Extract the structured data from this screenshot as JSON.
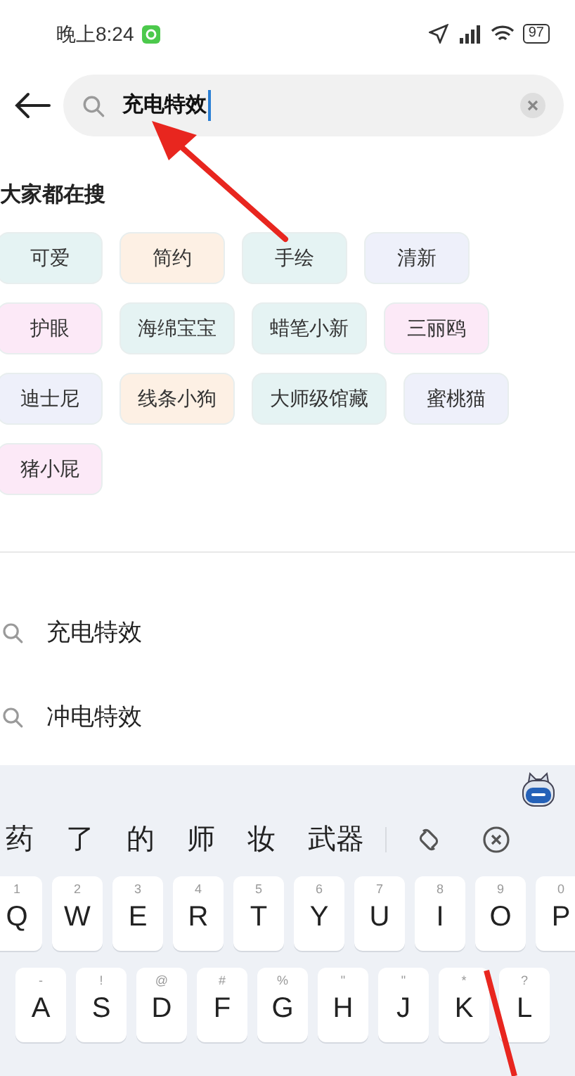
{
  "status_bar": {
    "time": "晚上8:24",
    "battery": "97"
  },
  "search": {
    "value": "充电特效"
  },
  "section_title": "大家都在搜",
  "tag_rows": [
    [
      {
        "label": "可爱",
        "color": "#e5f3f3"
      },
      {
        "label": "简约",
        "color": "#fdf0e4"
      },
      {
        "label": "手绘",
        "color": "#e5f3f3"
      },
      {
        "label": "清新",
        "color": "#eef0fa"
      }
    ],
    [
      {
        "label": "护眼",
        "color": "#fce9f7"
      },
      {
        "label": "海绵宝宝",
        "color": "#e5f3f3"
      },
      {
        "label": "蜡笔小新",
        "color": "#e5f3f3"
      },
      {
        "label": "三丽鸥",
        "color": "#fce9f7"
      }
    ],
    [
      {
        "label": "迪士尼",
        "color": "#eef0fa"
      },
      {
        "label": "线条小狗",
        "color": "#fdf0e4"
      },
      {
        "label": "大师级馆藏",
        "color": "#e5f3f3"
      },
      {
        "label": "蜜桃猫",
        "color": "#eef0fa"
      }
    ],
    [
      {
        "label": "猪小屁",
        "color": "#fce9f7"
      }
    ]
  ],
  "suggestions": [
    "充电特效",
    "冲电特效"
  ],
  "keyboard": {
    "candidates": [
      "药",
      "了",
      "的",
      "师",
      "妆",
      "武器"
    ],
    "rows": [
      [
        {
          "label": "Q",
          "hint": "1"
        },
        {
          "label": "W",
          "hint": "2"
        },
        {
          "label": "E",
          "hint": "3"
        },
        {
          "label": "R",
          "hint": "4"
        },
        {
          "label": "T",
          "hint": "5"
        },
        {
          "label": "Y",
          "hint": "6"
        },
        {
          "label": "U",
          "hint": "7"
        },
        {
          "label": "I",
          "hint": "8"
        },
        {
          "label": "O",
          "hint": "9"
        },
        {
          "label": "P",
          "hint": "0"
        }
      ],
      [
        {
          "label": "A",
          "hint": "-"
        },
        {
          "label": "S",
          "hint": "!"
        },
        {
          "label": "D",
          "hint": "@"
        },
        {
          "label": "F",
          "hint": "#"
        },
        {
          "label": "G",
          "hint": "%"
        },
        {
          "label": "H",
          "hint": "\""
        },
        {
          "label": "J",
          "hint": "\""
        },
        {
          "label": "K",
          "hint": "*"
        },
        {
          "label": "L",
          "hint": "?"
        }
      ]
    ]
  }
}
